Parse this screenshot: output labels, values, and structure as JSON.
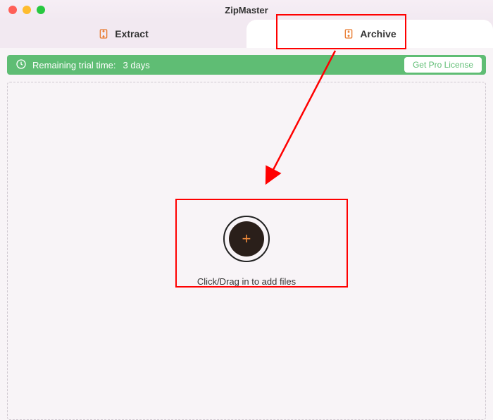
{
  "app": {
    "title": "ZipMaster"
  },
  "tabs": {
    "extract": {
      "label": "Extract"
    },
    "archive": {
      "label": "Archive"
    }
  },
  "trial": {
    "label": "Remaining trial time:",
    "value": "3 days",
    "button": "Get Pro License"
  },
  "dropzone": {
    "text": "Click/Drag in to add files"
  }
}
